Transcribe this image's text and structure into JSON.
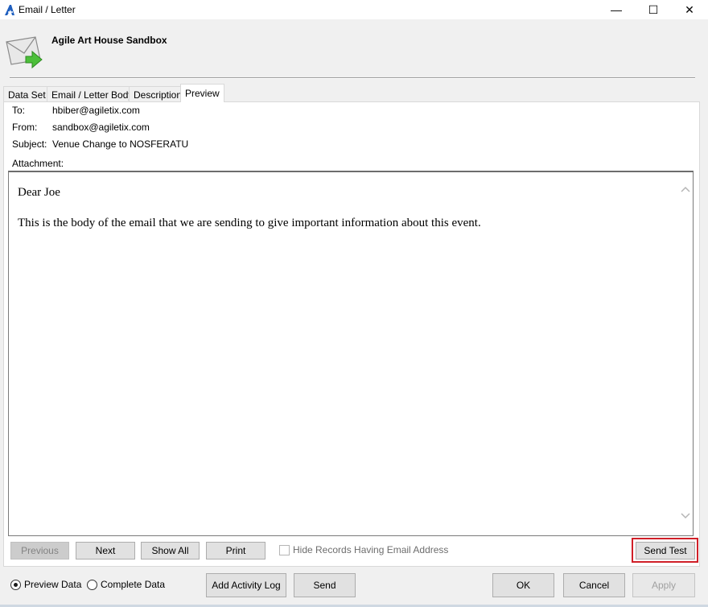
{
  "window": {
    "title": "Email / Letter",
    "minimize_glyph": "—",
    "maximize_glyph": "☐",
    "close_glyph": "✕"
  },
  "header": {
    "title": "Agile Art House Sandbox",
    "icon": "envelope-arrow-icon"
  },
  "tabs": [
    {
      "label": "Data Set",
      "active": false
    },
    {
      "label": "Email / Letter Body",
      "active": false
    },
    {
      "label": "Description",
      "active": false
    },
    {
      "label": "Preview",
      "active": true
    }
  ],
  "fields": {
    "to_label": "To:",
    "to_value": "hbiber@agiletix.com",
    "from_label": "From:",
    "from_value": "sandbox@agiletix.com",
    "subject_label": "Subject:",
    "subject_value": "Venue Change to NOSFERATU",
    "attachment_label": "Attachment:"
  },
  "preview": {
    "greeting": "Dear Joe",
    "body": "This is the body of the email that we are sending to give important information about this event."
  },
  "nav": {
    "previous": "Previous",
    "next": "Next",
    "show_all": "Show All",
    "print": "Print",
    "hide_records": "Hide Records Having Email Address",
    "send_test": "Send Test"
  },
  "footer": {
    "preview_data": "Preview Data",
    "complete_data": "Complete Data",
    "selected_mode": "Preview Data",
    "add_activity_log": "Add Activity Log",
    "send": "Send",
    "ok": "OK",
    "cancel": "Cancel",
    "apply": "Apply"
  },
  "colors": {
    "highlight": "#d01f28",
    "logo": "#1f5fbf"
  }
}
